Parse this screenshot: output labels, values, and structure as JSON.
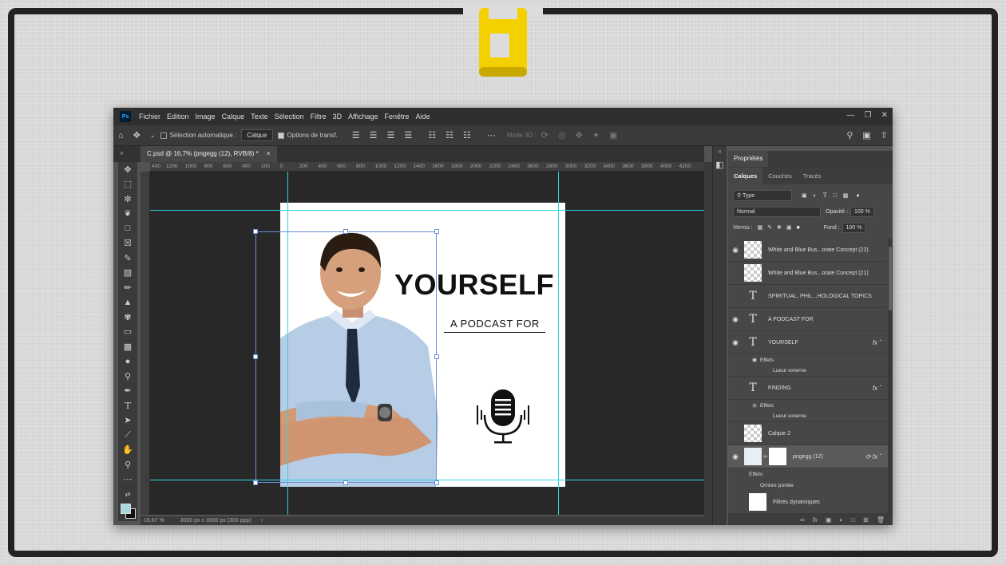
{
  "menu": {
    "items": [
      "Fichier",
      "Edition",
      "Image",
      "Calque",
      "Texte",
      "Sélection",
      "Filtre",
      "3D",
      "Affichage",
      "Fenêtre",
      "Aide"
    ]
  },
  "options_bar": {
    "auto_select_label": "Sélection automatique :",
    "auto_select_value": "Calque",
    "transform_label": "Options de transf.",
    "mode3d_label": "Mode 3D :"
  },
  "document": {
    "tab_title": "C.psd @ 16,7% (pngegg (12), RVB/8) *",
    "zoom": "16,67 %",
    "size_info": "3000 px x 3000 px (300 ppp)"
  },
  "ruler": {
    "labels": [
      "400",
      "1200",
      "1000",
      "800",
      "600",
      "400",
      "200",
      "0",
      "200",
      "400",
      "600",
      "800",
      "1000",
      "1200",
      "1400",
      "1600",
      "1800",
      "2000",
      "2200",
      "2400",
      "2600",
      "2800",
      "3000",
      "3200",
      "3400",
      "3600",
      "3800",
      "4000",
      "4200"
    ]
  },
  "artwork": {
    "headline": "YOURSELF",
    "subline": "A PODCAST FOR"
  },
  "panel": {
    "properties_title": "Propriétés",
    "tabs": [
      "Calques",
      "Couches",
      "Tracés"
    ],
    "filter_value": "Type",
    "blend_mode": "Normal",
    "opacity_label": "Opacité :",
    "opacity_value": "100 %",
    "lock_label": "Verrou :",
    "fill_label": "Fond :",
    "fill_value": "100 %"
  },
  "layers": [
    {
      "name": "White and Blue Bus...orate Concept (22)",
      "visible": true
    },
    {
      "name": "White and Blue Bus...orate Concept (21)",
      "visible": false
    },
    {
      "name": "SPIRITUAL,  PHIL...HOLOGICAL TOPICS",
      "visible": false
    },
    {
      "name": "A PODCAST FOR",
      "visible": true
    },
    {
      "name": "YOURSELF",
      "visible": true,
      "effects": "Effets",
      "effect": "Lueur externe"
    },
    {
      "name": "FINDING",
      "visible": false,
      "effects": "Effets",
      "effect": "Lueur externe"
    },
    {
      "name": "Calque 2",
      "visible": false
    },
    {
      "name": "pngegg (12)",
      "visible": true,
      "effects": "Effets",
      "effect": "Ombre portée",
      "smart_filters": "Filtres dynamiques"
    }
  ],
  "colors": {
    "accent_logo": "#f5d000",
    "guide": "#2fd3e0",
    "transform_box": "#6b8fd8"
  }
}
